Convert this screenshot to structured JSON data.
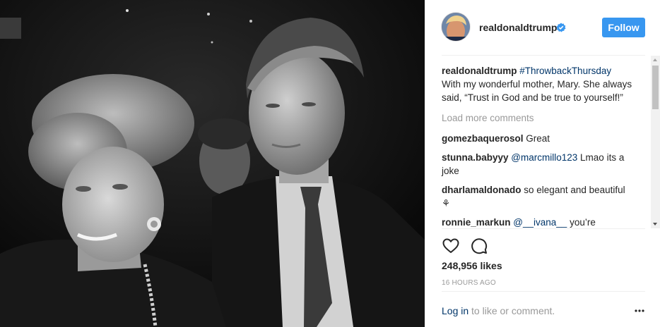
{
  "header": {
    "username": "realdonaldtrump",
    "follow_label": "Follow"
  },
  "caption": {
    "username": "realdonaldtrump",
    "hashtag": "#ThrowbackThursday",
    "text": "With my wonderful mother, Mary. She always said, “Trust in God and be true to yourself!”"
  },
  "load_more": "Load more comments",
  "comments": [
    {
      "user": "gomezbaquerosol",
      "mention": "",
      "text": "Great"
    },
    {
      "user": "stunna.babyyy",
      "mention": "@marcmillo123",
      "text": "Lmao its a joke"
    },
    {
      "user": "dharlamaldonado",
      "mention": "",
      "text": "so elegant and beautiful ⚘"
    },
    {
      "user": "ronnie_markun",
      "mention": "@__ivana__",
      "text": "you’re"
    }
  ],
  "likes": "248,956 likes",
  "timestamp": "16 HOURS AGO",
  "footer": {
    "login_link": "Log in",
    "login_rest": " to like or comment."
  },
  "colors": {
    "follow_button": "#3897f0",
    "link": "#003569",
    "verified": "#3897f0",
    "muted": "#999999"
  },
  "icons": [
    "verified-badge-icon",
    "heart-icon",
    "comment-icon",
    "more-options-icon"
  ]
}
